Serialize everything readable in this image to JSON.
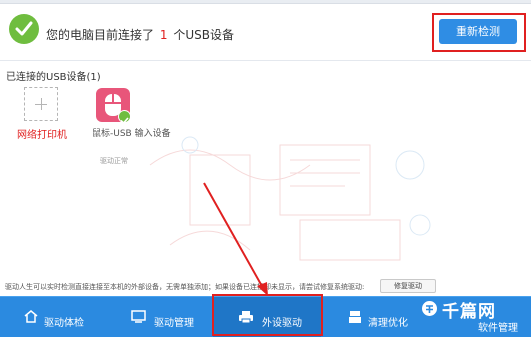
{
  "header": {
    "status_prefix": "您的电脑目前连接了",
    "status_count": "1",
    "status_suffix": "个USB设备",
    "redetect_label": "重新检测"
  },
  "section": {
    "title": "已连接的USB设备(1)"
  },
  "devices": [
    {
      "label": "网络打印机",
      "icon": "plus-icon",
      "status": ""
    },
    {
      "label": "鼠标-USB 输入设备",
      "icon": "mouse-icon",
      "status": "驱动正常"
    }
  ],
  "footer": {
    "note": "驱动人生可以实时检测直接连接至本机的外部设备，无需单独添加；如果设备已连接却未显示，请尝试修复系统驱动:",
    "repair_label": "修复驱动"
  },
  "nav": {
    "items": [
      {
        "label": "驱动体检",
        "icon": "home-icon"
      },
      {
        "label": "驱动管理",
        "icon": "monitor-icon"
      },
      {
        "label": "外设驱动",
        "icon": "printer-icon"
      },
      {
        "label": "清理优化",
        "icon": "broom-icon"
      },
      {
        "label": "软件管理",
        "icon": "apps-icon"
      }
    ],
    "active": "外设驱动"
  },
  "brand": {
    "text": "千篇网"
  },
  "colors": {
    "accent": "#2f8de4",
    "nav_bg": "#2b8ae0",
    "highlight": "#e02020",
    "success": "#6fbd3f",
    "device_pink": "#e8567a"
  }
}
